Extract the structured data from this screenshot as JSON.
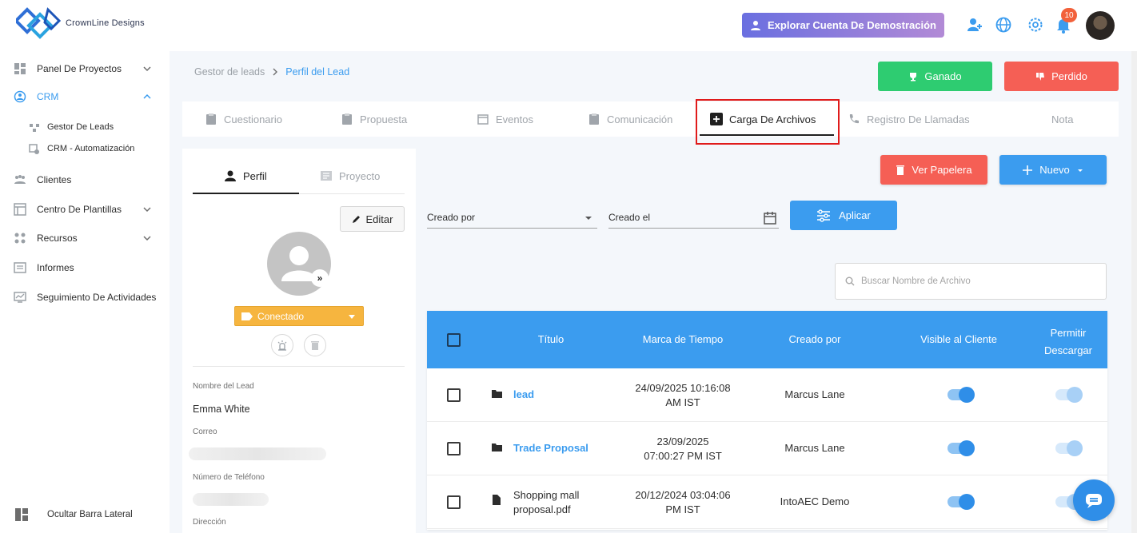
{
  "app": {
    "name": "CrownLine Designs"
  },
  "header": {
    "demo_button": "Explorar Cuenta De Demostración",
    "notifications_count": "10"
  },
  "sidebar": {
    "items": [
      {
        "label": "Panel De Proyectos"
      },
      {
        "label": "CRM"
      },
      {
        "label": "Gestor De Leads"
      },
      {
        "label": "CRM - Automatización"
      },
      {
        "label": "Clientes"
      },
      {
        "label": "Centro De Plantillas"
      },
      {
        "label": "Recursos"
      },
      {
        "label": "Informes"
      },
      {
        "label": "Seguimiento De Actividades"
      }
    ],
    "hide_label": "Ocultar Barra Lateral"
  },
  "breadcrumb": {
    "parent": "Gestor de leads",
    "current": "Perfil del Lead"
  },
  "actions": {
    "won": "Ganado",
    "lost": "Perdido"
  },
  "tabs": [
    {
      "label": "Cuestionario"
    },
    {
      "label": "Propuesta"
    },
    {
      "label": "Eventos"
    },
    {
      "label": "Comunicación"
    },
    {
      "label": "Carga De Archivos"
    },
    {
      "label": "Registro De Llamadas"
    },
    {
      "label": "Nota"
    }
  ],
  "profile": {
    "tab_profile": "Perfil",
    "tab_project": "Proyecto",
    "edit": "Editar",
    "status": "Conectado",
    "lead_name_label": "Nombre del Lead",
    "lead_name": "Emma White",
    "email_label": "Correo",
    "phone_label": "Número de Teléfono",
    "address_label": "Dirección"
  },
  "files": {
    "trash_button": "Ver Papelera",
    "new_button": "Nuevo",
    "filter_created_by": "Creado por",
    "filter_created_on": "Creado el",
    "apply_button": "Aplicar",
    "search_placeholder": "Buscar Nombre de Archivo",
    "columns": [
      "Título",
      "Marca de Tiempo",
      "Creado por",
      "Visible al Cliente",
      "Permitir Descargar"
    ],
    "rows": [
      {
        "title": "lead",
        "timestamp": "24/09/2025 10:16:08 AM IST",
        "ts_line1": "24/09/2025 10:16:08",
        "ts_line2": "AM IST",
        "created_by": "Marcus Lane",
        "type": "folder",
        "visible": true,
        "download": true
      },
      {
        "title": "Trade Proposal",
        "timestamp": "23/09/2025 07:00:27 PM IST",
        "ts_line1": "23/09/2025",
        "ts_line2": "07:00:27 PM IST",
        "created_by": "Marcus Lane",
        "type": "folder",
        "visible": true,
        "download": true
      },
      {
        "title": "Shopping mall proposal.pdf",
        "title_line1": "Shopping mall",
        "title_line2": "proposal.pdf",
        "timestamp": "20/12/2024 03:04:06 PM IST",
        "ts_line1": "20/12/2024 03:04:06",
        "ts_line2": "PM IST",
        "created_by": "IntoAEC Demo",
        "type": "file",
        "visible": true,
        "download": true
      }
    ]
  },
  "colors": {
    "primary": "#3b9cef",
    "success": "#2ecc71",
    "danger": "#f55f55",
    "status": "#f6b53f",
    "highlight": "#e01b1b"
  }
}
